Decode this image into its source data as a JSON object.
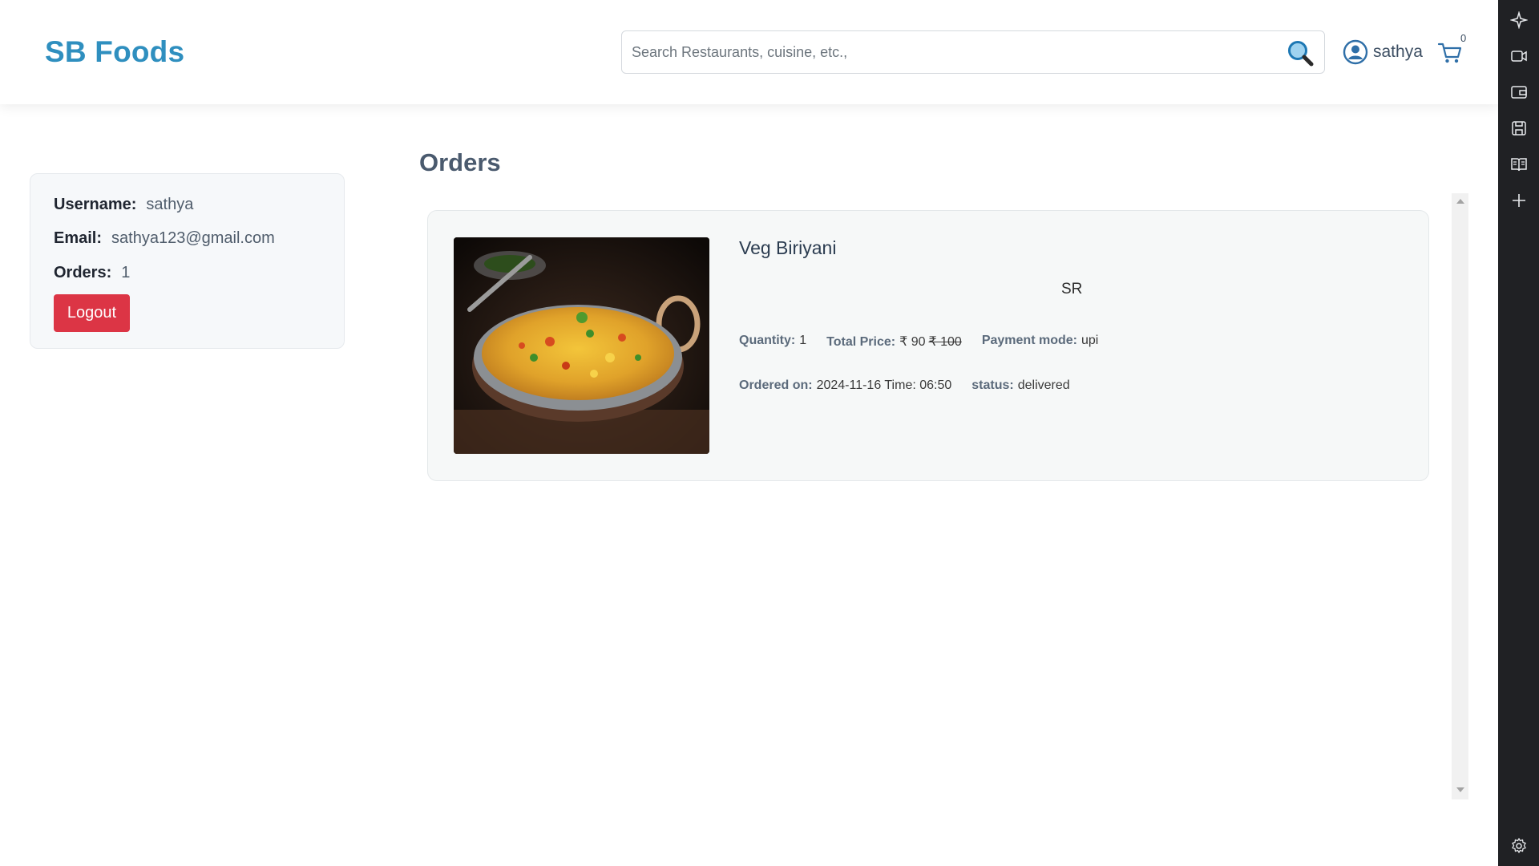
{
  "header": {
    "brand": "SB Foods",
    "search_placeholder": "Search Restaurants, cuisine, etc.,",
    "username": "sathya",
    "cart_count": "0"
  },
  "sidebar_rail": {
    "icons": [
      "sparkle-icon",
      "video-icon",
      "wallet-icon",
      "save-icon",
      "reader-icon",
      "plus-icon",
      "settings-icon"
    ]
  },
  "profile": {
    "username_label": "Username:",
    "username": "sathya",
    "email_label": "Email:",
    "email": "sathya123@gmail.com",
    "orders_label": "Orders:",
    "orders_count": "1",
    "logout_label": "Logout"
  },
  "orders": {
    "title": "Orders",
    "items": [
      {
        "name": "Veg Biriyani",
        "restaurant": "SR",
        "quantity_label": "Quantity:",
        "quantity": "1",
        "total_price_label": "Total Price:",
        "price": "₹ 90",
        "old_price": "₹ 100",
        "payment_label": "Payment mode:",
        "payment_mode": "upi",
        "ordered_on_label": "Ordered on:",
        "ordered_on": "2024-11-16 Time: 06:50",
        "status_label": "status:",
        "status": "delivered"
      }
    ]
  },
  "colors": {
    "brand": "#2f8fbf",
    "logout": "#dc3545",
    "rail": "#202124"
  }
}
